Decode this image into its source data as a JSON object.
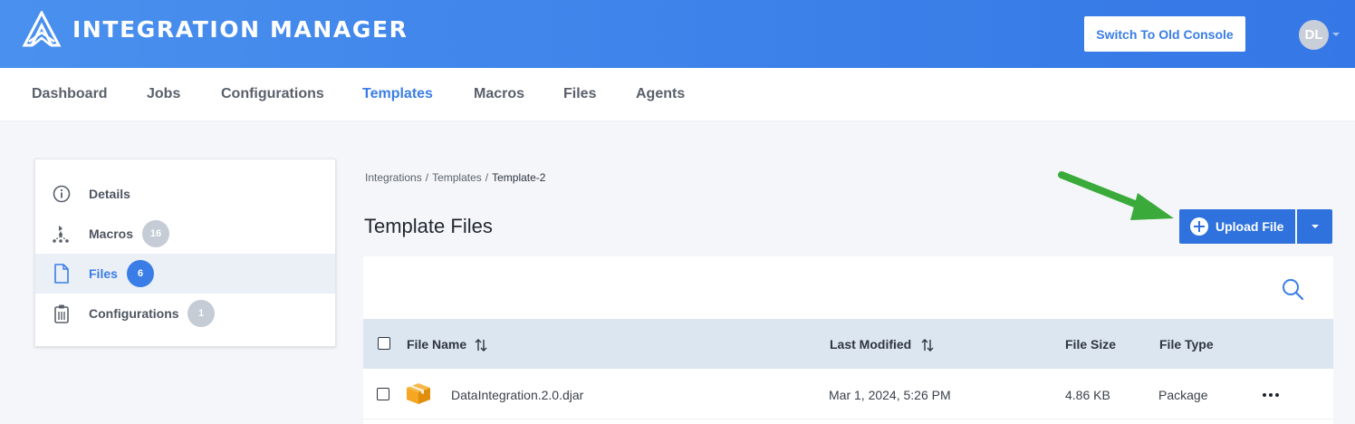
{
  "app": {
    "title": "INTEGRATION MANAGER",
    "old_console_label": "Switch To Old Console",
    "avatar_initials": "DL",
    "brand_color": "#3d83ea"
  },
  "nav": {
    "items": [
      {
        "label": "Dashboard",
        "active": false
      },
      {
        "label": "Jobs",
        "active": false
      },
      {
        "label": "Configurations",
        "active": false
      },
      {
        "label": "Templates",
        "active": true
      },
      {
        "label": "Macros",
        "active": false
      },
      {
        "label": "Files",
        "active": false
      },
      {
        "label": "Agents",
        "active": false
      }
    ]
  },
  "sidebar": {
    "items": [
      {
        "label": "Details",
        "icon": "info-icon",
        "badge": null,
        "active": false
      },
      {
        "label": "Macros",
        "icon": "macro-flow-icon",
        "badge": "16",
        "active": false
      },
      {
        "label": "Files",
        "icon": "file-icon",
        "badge": "6",
        "active": true
      },
      {
        "label": "Configurations",
        "icon": "clipboard-icon",
        "badge": "1",
        "active": false
      }
    ]
  },
  "breadcrumb": {
    "items": [
      "Integrations",
      "Templates",
      "Template-2"
    ]
  },
  "main": {
    "title": "Template Files",
    "upload_label": "Upload File"
  },
  "table": {
    "columns": [
      "File Name",
      "Last Modified",
      "File Size",
      "File Type"
    ],
    "rows": [
      {
        "name": "DataIntegration.2.0.djar",
        "modified": "Mar 1, 2024, 5:26 PM",
        "size": "4.86 KB",
        "type": "Package",
        "icon": "package-box-icon"
      }
    ]
  },
  "colors": {
    "accent": "#3a7de6",
    "button": "#2f72de",
    "annotation_arrow": "#3aaa3a",
    "package_icon": "#f5a623"
  }
}
